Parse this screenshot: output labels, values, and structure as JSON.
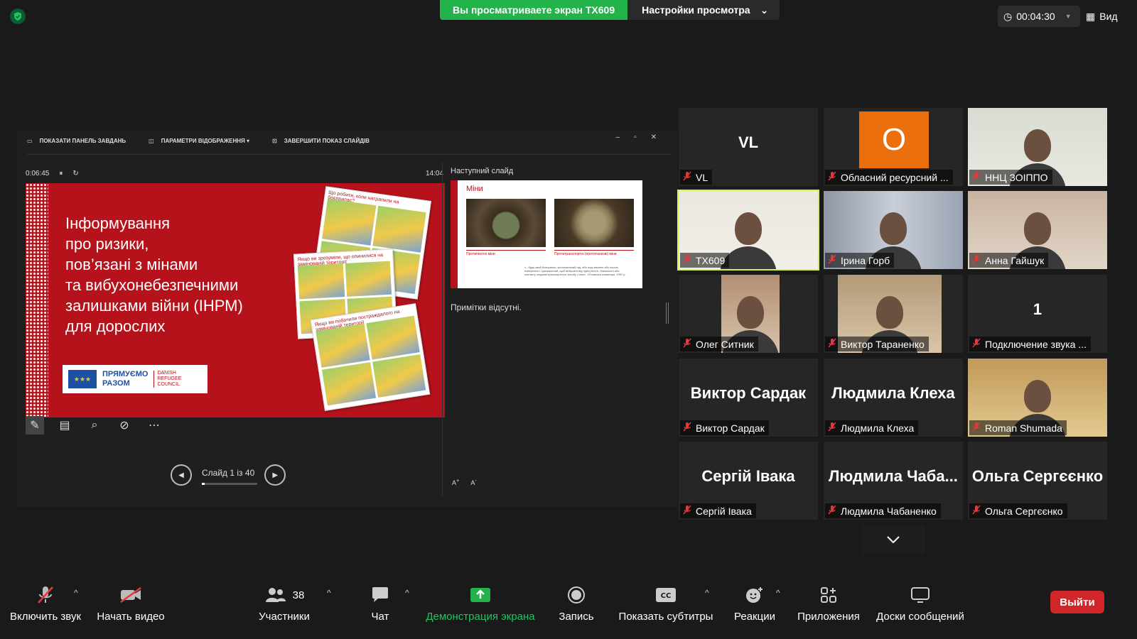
{
  "topbar": {
    "sharing_text": "Вы просматриваете экран TX609",
    "view_options": "Настройки просмотра",
    "timer": "00:04:30",
    "view_label": "Вид"
  },
  "ppt": {
    "toolbar": [
      "ПОКАЗАТИ ПАНЕЛЬ ЗАВДАНЬ",
      "ПАРАМЕТРИ ВІДОБРАЖЕННЯ ▾",
      "ЗАВЕРШИТИ ПОКАЗ СЛАЙДІВ"
    ],
    "elapsed": "0:06:45",
    "clock": "14:04",
    "slide_title": "Інформування\nпро ризики,\nпов’язані з мінами\nта вибухонебезпечними\nзалишками війни (ІНРМ)\nдля дорослих",
    "logo_text": "ПРЯМУЄМО\nРАЗОМ",
    "drc_text": "DANISH\nREFUGEE\nCOUNCIL",
    "comic_titles": [
      "Що робити, коли натрапили на боєприпас?",
      "Якщо ви зрозуміли, що опинилися на замінованій території",
      "Якщо ви побачили постраждалого на замінованій території"
    ],
    "slide_counter": "Слайд 1 із 40",
    "next_label": "Наступний слайд",
    "next_title": "Міни",
    "next_cap1": "Протипіхотні міни",
    "next_cap2": "Протитранспортні (протитанкові) міни",
    "next_text": "«...будь-який боєприпас, встановлений під, або над землею або іншою поверхнею і призначений, щоб вибухати від присутності, близькості або контакту людини/транспортного засобу з ним». Оттавська конвенція, 1997 р.",
    "notes": "Примітки відсутні."
  },
  "participants": [
    {
      "name": "VL",
      "big": "VL",
      "kind": "text"
    },
    {
      "name": "Обласний ресурсний ...",
      "big": "O",
      "kind": "orange"
    },
    {
      "name": "ННЦ ЗОІППО",
      "kind": "video"
    },
    {
      "name": "TX609",
      "kind": "video",
      "active": true
    },
    {
      "name": "Ірина Горб",
      "kind": "video"
    },
    {
      "name": "Анна Гайшук",
      "kind": "video"
    },
    {
      "name": "Олег Ситник",
      "kind": "video"
    },
    {
      "name": "Виктор Тараненко",
      "kind": "video"
    },
    {
      "name": "Подключение звука ...",
      "big": "1",
      "kind": "text"
    },
    {
      "name": "Виктор Сардак",
      "big": "Виктор Сардак",
      "kind": "text"
    },
    {
      "name": "Людмила Клеха",
      "big": "Людмила Клеха",
      "kind": "text"
    },
    {
      "name": "Roman Shumada",
      "kind": "video"
    },
    {
      "name": "Сергій Івака",
      "big": "Сергій Івака",
      "kind": "text"
    },
    {
      "name": "Людмила Чабаненко",
      "big": "Людмила  Чаба...",
      "kind": "text"
    },
    {
      "name": "Ольга Сергєєнко",
      "big": "Ольга Сергєєнко",
      "kind": "text"
    }
  ],
  "toolbar": {
    "unmute": "Включить звук",
    "start_video": "Начать видео",
    "participants": "Участники",
    "participants_count": "38",
    "chat": "Чат",
    "share": "Демонстрация экрана",
    "record": "Запись",
    "captions": "Показать субтитры",
    "reactions": "Реакции",
    "apps": "Приложения",
    "whiteboards": "Доски сообщений",
    "leave": "Выйти"
  },
  "colors": {
    "accent_green": "#22b34a",
    "active_speaker": "#d6f25b",
    "leave_red": "#d0262a",
    "slide_red": "#b5121b"
  }
}
